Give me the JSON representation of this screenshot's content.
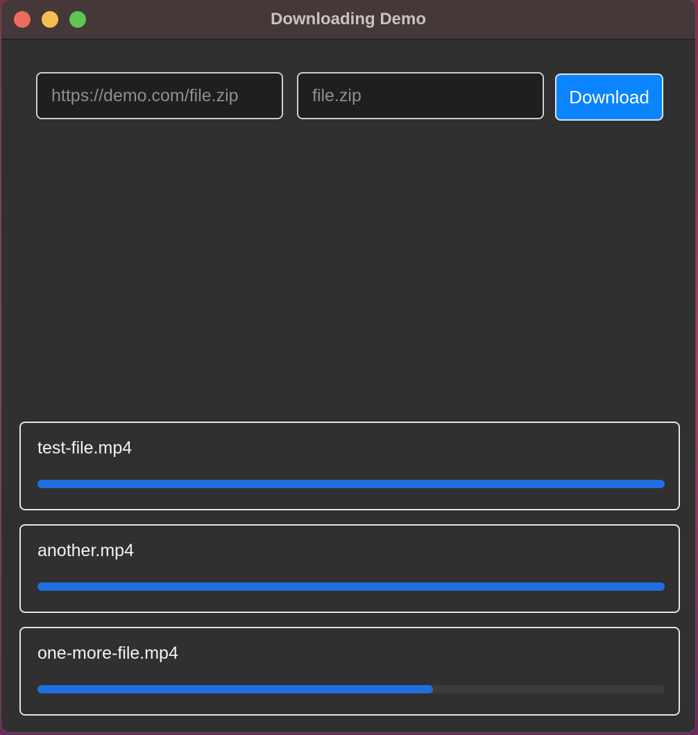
{
  "window": {
    "title": "Downloading Demo"
  },
  "form": {
    "url_placeholder": "https://demo.com/file.zip",
    "name_placeholder": "file.zip",
    "download_label": "Download"
  },
  "downloads": [
    {
      "name": "test-file.mp4",
      "progress": 1.0
    },
    {
      "name": "another.mp4",
      "progress": 1.0
    },
    {
      "name": "one-more-file.mp4",
      "progress": 0.63
    }
  ],
  "colors": {
    "accent": "#0a84ff",
    "progress": "#1f6fe0",
    "background": "#303030"
  }
}
